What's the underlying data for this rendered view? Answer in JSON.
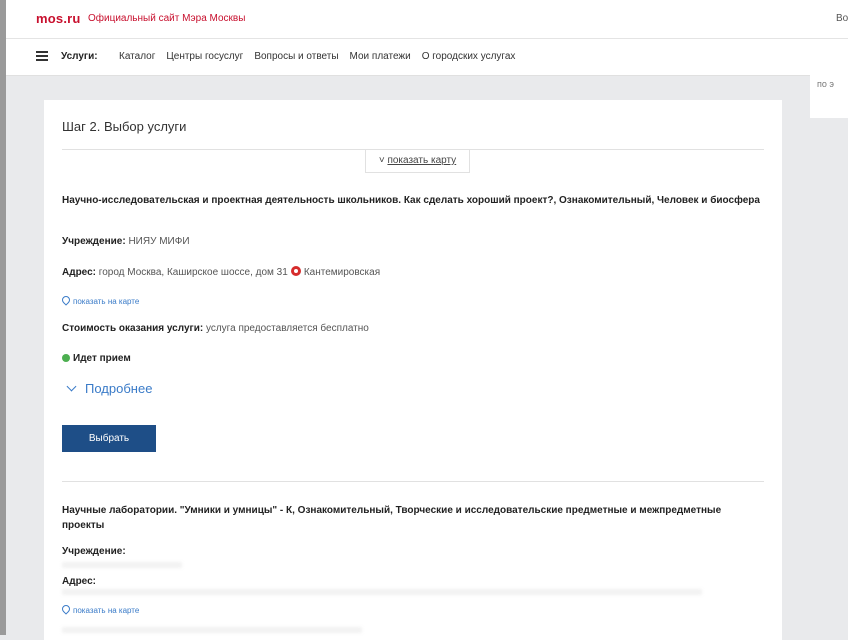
{
  "header": {
    "logo": "mos.ru",
    "site_title": "Официальный сайт Мэра Москвы",
    "right_text": "Во"
  },
  "nav": {
    "label": "Услуги:",
    "items": [
      "Каталог",
      "Центры госуслуг",
      "Вопросы и ответы",
      "Мои платежи",
      "О городских услугах"
    ]
  },
  "side": {
    "text": "по э"
  },
  "page": {
    "step_title": "Шаг 2. Выбор услуги",
    "map_toggle": "показать карту"
  },
  "service1": {
    "title": "Научно-исследовательская и проектная деятельность школьников. Как сделать хороший проект?, Ознакомительный, Человек и биосфера",
    "institution_label": "Учреждение:",
    "institution_value": "НИЯУ МИФИ",
    "address_label": "Адрес:",
    "address_value": "город Москва, Каширское шоссе, дом 31",
    "metro": "Кантемировская",
    "map_link": "показать на карте",
    "cost_label": "Стоимость оказания услуги:",
    "cost_value": "услуга предоставляется бесплатно",
    "status": "Идет прием",
    "more": "Подробнее",
    "select_button": "Выбрать"
  },
  "service2": {
    "title": "Научные лаборатории. \"Умники и умницы\" - К, Ознакомительный, Творческие и исследовательские предметные и межпредметные проекты",
    "institution_label": "Учреждение:",
    "address_label": "Адрес:",
    "map_link": "показать на карте"
  },
  "colors": {
    "brand_red": "#c8102e",
    "button_blue": "#1e4e87",
    "link_blue": "#3a7bc8",
    "status_green": "#4caf50"
  }
}
